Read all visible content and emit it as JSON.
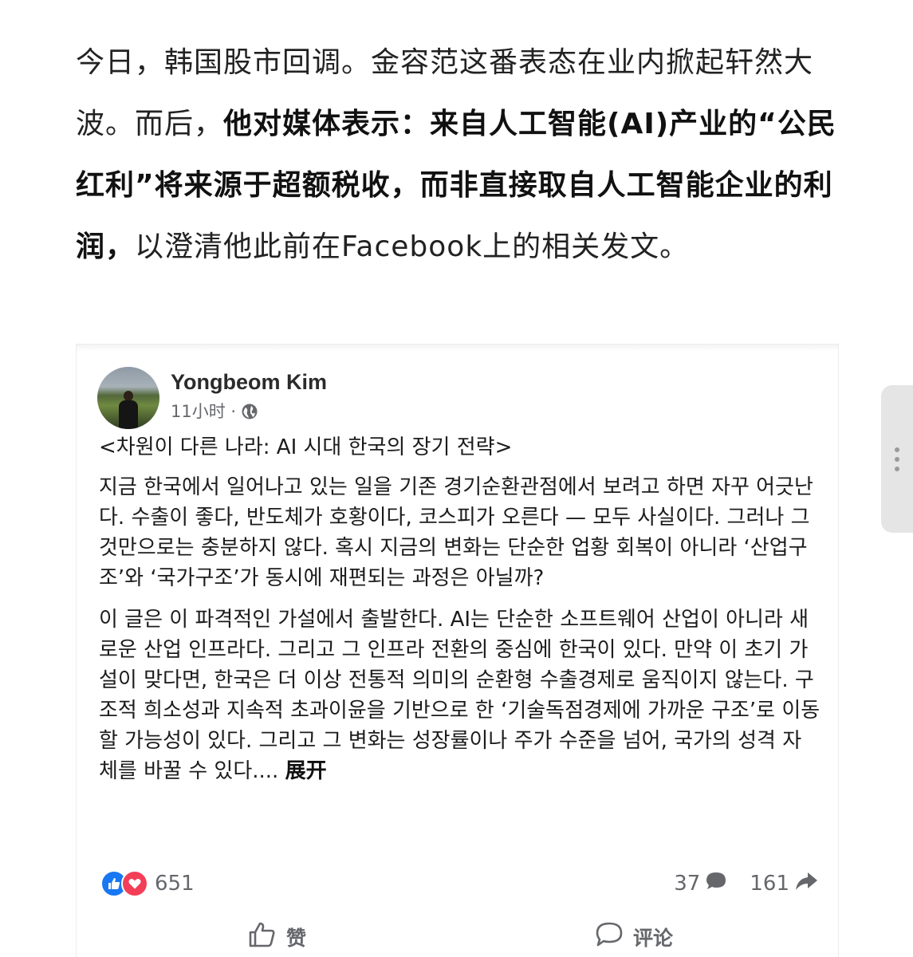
{
  "article": {
    "p1": "今日，韩国股市回调。金容范这番表态在业内掀起轩然大波。而后，",
    "p1_bold": "他对媒体表示：来自人工智能(AI)产业的“公民红利”将来源于超额税收，而非直接取自人工智能企业的利润，",
    "p1_end": "以澄清他此前在Facebook上的相关发文。"
  },
  "post": {
    "author": "Yongbeom Kim",
    "time": "11小时 ·",
    "title": "<차원이 다른 나라: AI 시대 한국의 장기 전략>",
    "paragraph1": "지금 한국에서 일어나고 있는 일을 기존 경기순환관점에서 보려고 하면 자꾸 어긋난다. 수출이 좋다, 반도체가 호황이다, 코스피가 오른다 — 모두 사실이다. 그러나 그것만으로는 충분하지 않다. 혹시 지금의 변화는 단순한 업황 회복이 아니라 ‘산업구조’와 ‘국가구조’가 동시에 재편되는 과정은 아닐까?",
    "paragraph2": "이 글은 이 파격적인 가설에서 출발한다. AI는 단순한 소프트웨어 산업이 아니라 새로운 산업 인프라다. 그리고 그 인프라 전환의 중심에 한국이 있다. 만약 이 초기 가설이 맞다면, 한국은 더 이상 전통적 의미의 순환형 수출경제로 움직이지 않는다. 구조적 희소성과 지속적 초과이윤을 기반으로 한 ‘기술독점경제에 가까운 구조’로 이동할 가능성이 있다. 그리고 그 변화는 성장률이나 주가 수준을 넘어, 국가의 성격 자체를 바꿀 수 있다....",
    "expand": "展开",
    "reactions_count": "651",
    "comments_count": "37",
    "shares_count": "161",
    "like_label": "赞",
    "comment_label": "评论"
  },
  "colors": {
    "like_blue": "#1877f2",
    "love_red": "#f33e58",
    "meta_gray": "#65676b"
  },
  "icons": [
    "globe-icon",
    "like-reaction-icon",
    "love-reaction-icon",
    "comment-icon",
    "share-icon",
    "thumbs-up-icon",
    "comment-bubble-icon"
  ]
}
